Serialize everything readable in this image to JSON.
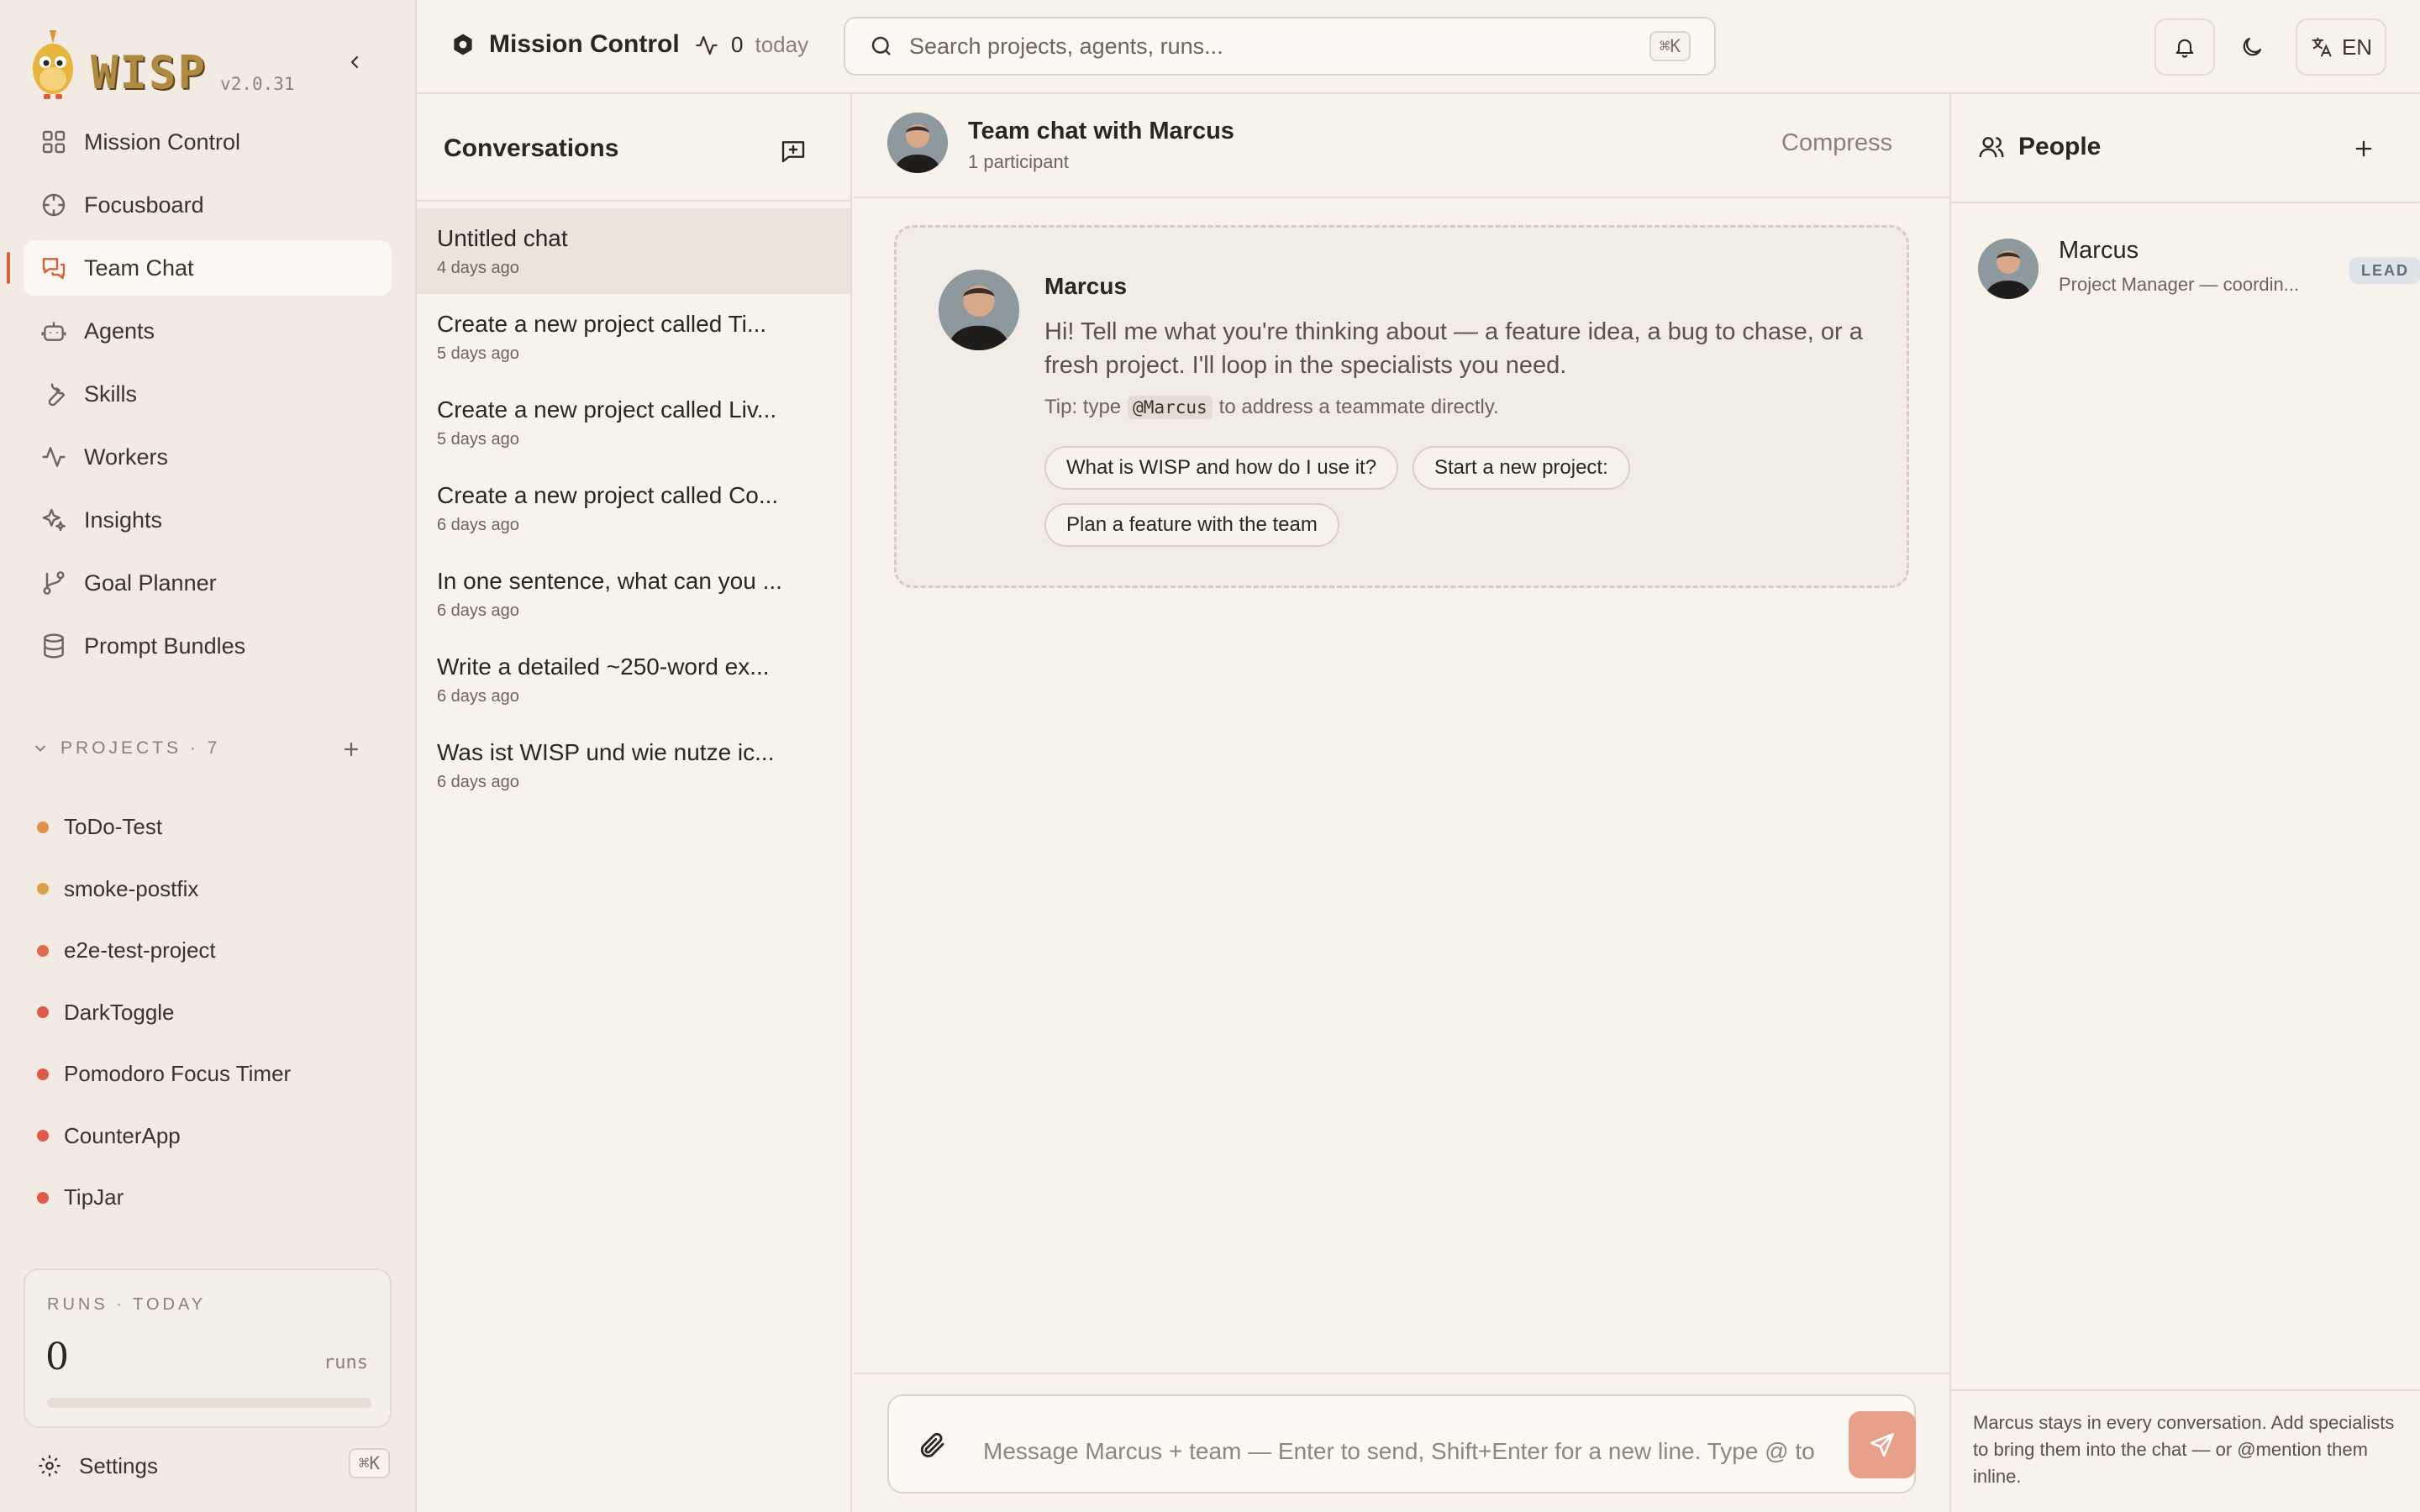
{
  "brand": {
    "name": "WISP",
    "version": "v2.0.31"
  },
  "nav": {
    "items": [
      {
        "label": "Mission Control",
        "icon": "grid-icon"
      },
      {
        "label": "Focusboard",
        "icon": "crosshair-icon"
      },
      {
        "label": "Team Chat",
        "icon": "chat-bubbles-icon",
        "active": true
      },
      {
        "label": "Agents",
        "icon": "robot-icon"
      },
      {
        "label": "Skills",
        "icon": "wrench-icon"
      },
      {
        "label": "Workers",
        "icon": "activity-icon"
      },
      {
        "label": "Insights",
        "icon": "sparkles-icon"
      },
      {
        "label": "Goal Planner",
        "icon": "git-branch-icon"
      },
      {
        "label": "Prompt Bundles",
        "icon": "database-icon"
      }
    ]
  },
  "projects": {
    "header": "PROJECTS · 7",
    "items": [
      {
        "name": "ToDo-Test",
        "color": "#e0904a"
      },
      {
        "name": "smoke-postfix",
        "color": "#d9a04a"
      },
      {
        "name": "e2e-test-project",
        "color": "#e06a4a"
      },
      {
        "name": "DarkToggle",
        "color": "#e05a4a"
      },
      {
        "name": "Pomodoro Focus Timer",
        "color": "#e05a4a"
      },
      {
        "name": "CounterApp",
        "color": "#e05a4a"
      },
      {
        "name": "TipJar",
        "color": "#e05a4a"
      }
    ]
  },
  "runs": {
    "label": "RUNS · TODAY",
    "value": "0",
    "unit": "runs",
    "progress": 0
  },
  "settings": {
    "label": "Settings",
    "shortcut": "⌘K"
  },
  "topbar": {
    "title": "Mission Control",
    "activity_count": "0",
    "activity_label": "today",
    "search_placeholder": "Search projects, agents, runs...",
    "search_shortcut": "⌘K",
    "language": "EN"
  },
  "conversations": {
    "title": "Conversations",
    "items": [
      {
        "title": "Untitled chat",
        "time": "4 days ago",
        "active": true
      },
      {
        "title": "Create a new project called Ti...",
        "time": "5 days ago"
      },
      {
        "title": "Create a new project called Liv...",
        "time": "5 days ago"
      },
      {
        "title": "Create a new project called Co...",
        "time": "6 days ago"
      },
      {
        "title": "In one sentence, what can you ...",
        "time": "6 days ago"
      },
      {
        "title": "Write a detailed ~250-word ex...",
        "time": "6 days ago"
      },
      {
        "title": "Was ist WISP und wie nutze ic...",
        "time": "6 days ago"
      }
    ]
  },
  "chat": {
    "title": "Team chat with Marcus",
    "subtitle": "1 participant",
    "compress_label": "Compress",
    "welcome": {
      "name": "Marcus",
      "text": "Hi! Tell me what you're thinking about — a feature idea, a bug to chase, or a fresh project. I'll loop in the specialists you need.",
      "tip_prefix": "Tip: type",
      "tip_code": "@Marcus",
      "tip_suffix": "to address a teammate directly.",
      "suggestions": [
        "What is WISP and how do I use it?",
        "Start a new project:",
        "Plan a feature with the team"
      ]
    },
    "composer_placeholder": "Message Marcus + team — Enter to send, Shift+Enter for a new line. Type @ to"
  },
  "people": {
    "title": "People",
    "members": [
      {
        "name": "Marcus",
        "role": "Project Manager — coordin...",
        "badge": "LEAD"
      }
    ],
    "footer": "Marcus stays in every conversation. Add specialists to bring them into the chat — or @mention them inline."
  },
  "colors": {
    "accent": "#d9623d",
    "send_button": "#e8a08a",
    "background": "#f7f3ec",
    "sidebar": "#f1ebe3"
  }
}
